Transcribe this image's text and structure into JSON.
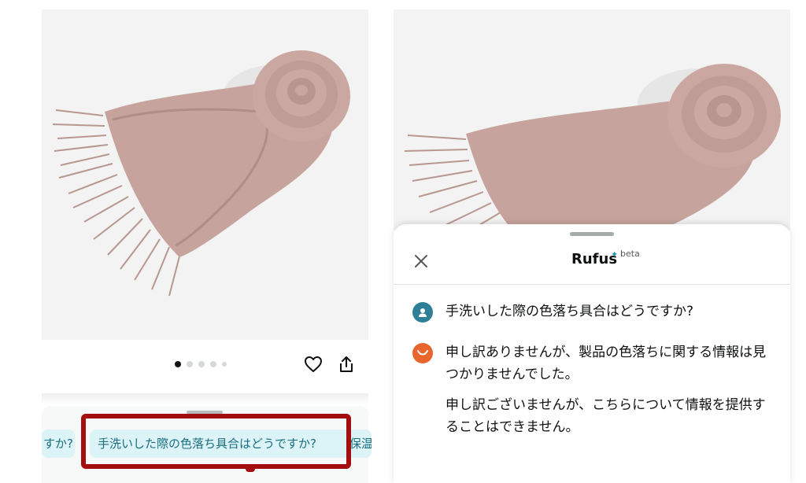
{
  "left_panel": {
    "carousel": {
      "count": 5,
      "active_index": 0
    },
    "suggestion_chips": {
      "prev_partial": "すか?",
      "main": "手洗いした際の色落ち具合はどうですか?",
      "next_partial": "保温"
    },
    "icons": {
      "favorite": "heart-icon",
      "share": "share-icon"
    },
    "highlight_color": "#a50e0e"
  },
  "right_panel": {
    "assistant_name": "Rufus",
    "badge": "beta",
    "close_icon": "close-icon",
    "conversation": [
      {
        "role": "user",
        "text": "手洗いした際の色落ち具合はどうですか?"
      },
      {
        "role": "assistant",
        "text": "申し訳ありませんが、製品の色落ちに関する情報は見つかりませんでした。"
      },
      {
        "role": "assistant",
        "text": "申し訳ございませんが、こちらについて情報を提供することはできません。"
      }
    ]
  },
  "colors": {
    "chip_bg": "#dcf3f7",
    "chip_text": "#1a6f80",
    "user_avatar": "#2f7f96",
    "bot_avatar": "#e8652c",
    "scarf": "#c6a39c"
  }
}
